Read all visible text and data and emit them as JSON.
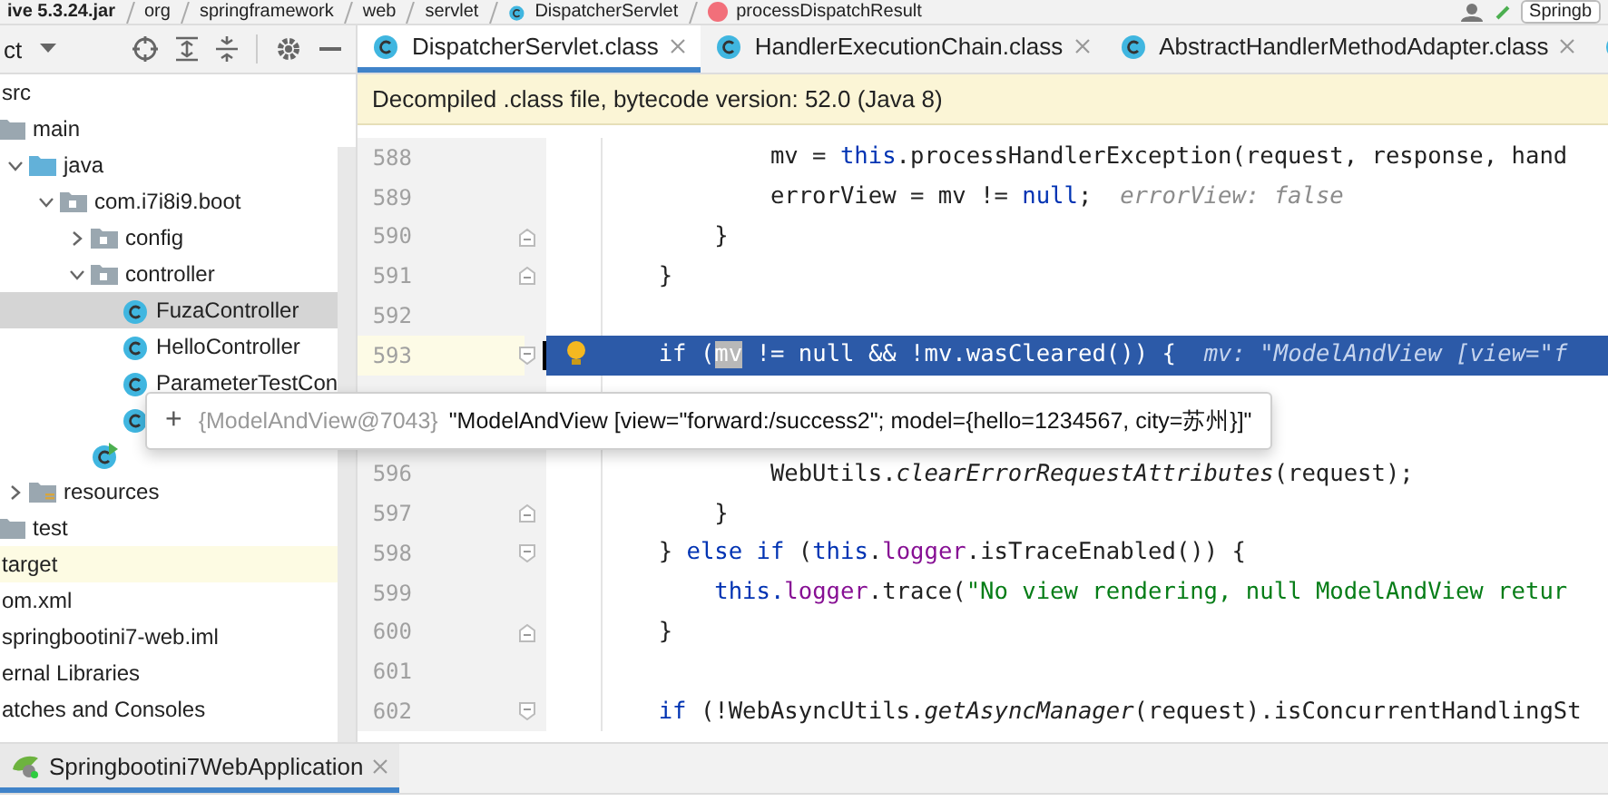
{
  "breadcrumbs": [
    {
      "label": "ive 5.3.24.jar",
      "kind": "jar"
    },
    {
      "label": "org",
      "kind": "package"
    },
    {
      "label": "springframework",
      "kind": "package"
    },
    {
      "label": "web",
      "kind": "package"
    },
    {
      "label": "servlet",
      "kind": "package"
    },
    {
      "label": "DispatcherServlet",
      "kind": "class"
    },
    {
      "label": "processDispatchResult",
      "kind": "method"
    }
  ],
  "run_config": {
    "label": "Springb"
  },
  "project_panel": {
    "title": "ct",
    "tree": [
      {
        "label": "src",
        "kind": "plain",
        "selected": false,
        "children": [
          {
            "label": "main",
            "kind": "folder",
            "selected": false,
            "children": [
              {
                "label": "java",
                "kind": "src-folder",
                "expanded": true,
                "selected": false,
                "children": [
                  {
                    "label": "com.i7i8i9.boot",
                    "kind": "package",
                    "expanded": true,
                    "selected": false,
                    "children": [
                      {
                        "label": "config",
                        "kind": "package",
                        "expanded": false,
                        "selected": false
                      },
                      {
                        "label": "controller",
                        "kind": "package",
                        "expanded": true,
                        "selected": false,
                        "children": [
                          {
                            "label": "FuzaController",
                            "kind": "class",
                            "selected": true
                          },
                          {
                            "label": "HelloController",
                            "kind": "class",
                            "selected": false
                          },
                          {
                            "label": "ParameterTestCon",
                            "kind": "class",
                            "selected": false
                          },
                          {
                            "kind": "class",
                            "selected": false
                          }
                        ]
                      },
                      {
                        "kind": "run-class",
                        "selected": false
                      }
                    ]
                  }
                ]
              },
              {
                "label": "resources",
                "kind": "resources-folder",
                "expanded": false,
                "selected": false
              }
            ]
          },
          {
            "label": "test",
            "kind": "folder",
            "selected": false
          }
        ]
      },
      {
        "label": "target",
        "kind": "excluded",
        "selected": false
      },
      {
        "label": "om.xml",
        "kind": "plain",
        "selected": false
      },
      {
        "label": "springbootini7-web.iml",
        "kind": "plain",
        "selected": false
      },
      {
        "label": "ernal Libraries",
        "kind": "plain",
        "selected": false
      },
      {
        "label": "atches and Consoles",
        "kind": "plain",
        "selected": false
      }
    ]
  },
  "editor_tabs": [
    {
      "label": "DispatcherServlet.class",
      "selected": true
    },
    {
      "label": "HandlerExecutionChain.class",
      "selected": false
    },
    {
      "label": "AbstractHandlerMethodAdapter.class",
      "selected": false
    },
    {
      "selected": false
    }
  ],
  "notice": "Decompiled .class file, bytecode version: 52.0 (Java 8)",
  "code_lines": [
    {
      "number": "588",
      "current": false,
      "kind": "plain",
      "tokens": [
        {
          "text": "            mv = ",
          "kind": "plain"
        },
        {
          "text": "this",
          "kind": "keyword"
        },
        {
          "text": ".processHandlerException(request, response, hand",
          "kind": "plain"
        }
      ]
    },
    {
      "number": "589",
      "current": false,
      "kind": "plain",
      "tokens": [
        {
          "text": "            errorView = mv != ",
          "kind": "plain"
        },
        {
          "text": "null",
          "kind": "keyword"
        },
        {
          "text": ";",
          "kind": "plain"
        }
      ],
      "hint": "errorView: false"
    },
    {
      "number": "590",
      "current": false,
      "kind": "fold-end",
      "tokens": [
        {
          "text": "        }",
          "kind": "plain"
        }
      ]
    },
    {
      "number": "591",
      "current": false,
      "kind": "fold-end",
      "tokens": [
        {
          "text": "    }",
          "kind": "plain"
        }
      ]
    },
    {
      "number": "592",
      "current": false,
      "kind": "plain"
    },
    {
      "number": "593",
      "current": true,
      "kind": "fold-start",
      "tokens": [
        {
          "text": "    if",
          "kind": "keyword"
        },
        {
          "text": " (",
          "kind": "plain"
        },
        {
          "text": "mv",
          "kind": "var-highlight"
        },
        {
          "text": " != ",
          "kind": "plain"
        },
        {
          "text": "null",
          "kind": "keyword"
        },
        {
          "text": " && !mv.wasCleared()) {",
          "kind": "plain"
        }
      ],
      "hint": "mv: \"ModelAndView [view=\"f"
    },
    {
      "current": false,
      "kind": "plain"
    },
    {
      "current": false,
      "kind": "plain"
    },
    {
      "number": "596",
      "current": false,
      "kind": "plain",
      "tokens": [
        {
          "text": "            WebUtils.",
          "kind": "plain"
        },
        {
          "text": "clearErrorRequestAttributes",
          "kind": "static-call"
        },
        {
          "text": "(request);",
          "kind": "plain"
        }
      ]
    },
    {
      "number": "597",
      "current": false,
      "kind": "fold-end",
      "tokens": [
        {
          "text": "        }",
          "kind": "plain"
        }
      ]
    },
    {
      "number": "598",
      "current": false,
      "kind": "fold-start",
      "tokens": [
        {
          "text": "    } ",
          "kind": "plain"
        },
        {
          "text": "else if",
          "kind": "keyword"
        },
        {
          "text": " (",
          "kind": "plain"
        },
        {
          "text": "this",
          "kind": "keyword"
        },
        {
          "text": ".",
          "kind": "plain"
        },
        {
          "text": "logger",
          "kind": "field"
        },
        {
          "text": ".isTraceEnabled()) {",
          "kind": "plain"
        }
      ]
    },
    {
      "number": "599",
      "current": false,
      "kind": "plain",
      "tokens": [
        {
          "text": "        this.",
          "kind": "keyword"
        },
        {
          "text": "logger",
          "kind": "field"
        },
        {
          "text": ".trace(",
          "kind": "plain"
        },
        {
          "text": "\"No view rendering, null ModelAndView retur",
          "kind": "string"
        }
      ]
    },
    {
      "number": "600",
      "current": false,
      "kind": "fold-end",
      "tokens": [
        {
          "text": "    }",
          "kind": "plain"
        }
      ]
    },
    {
      "number": "601",
      "current": false,
      "kind": "plain"
    },
    {
      "number": "602",
      "current": false,
      "kind": "fold-start",
      "tokens": [
        {
          "text": "    if",
          "kind": "keyword"
        },
        {
          "text": " (!WebAsyncUtils.",
          "kind": "plain"
        },
        {
          "text": "getAsyncManager",
          "kind": "static-call"
        },
        {
          "text": "(request).isConcurrentHandlingSt",
          "kind": "plain"
        }
      ]
    }
  ],
  "value_popup": {
    "expand": "+",
    "type": "{ModelAndView@7043}",
    "value": "\"ModelAndView [view=\"forward:/success2\"; model={hello=1234567, city=苏州}]\""
  },
  "run_tabs": [
    {
      "label": "Springbootini7WebApplication",
      "selected": true
    }
  ]
}
